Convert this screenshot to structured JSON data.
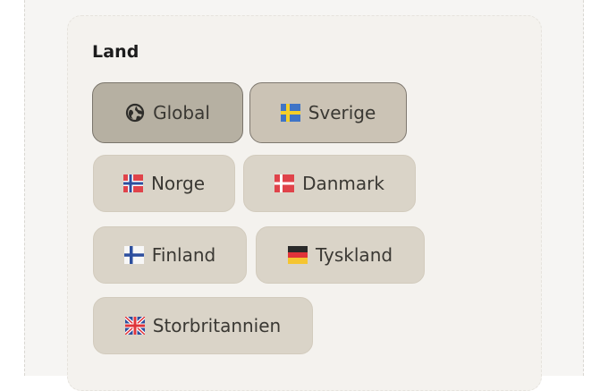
{
  "section": {
    "label": "Land"
  },
  "countries": [
    {
      "label": "Global",
      "icon": "globe-icon",
      "state": "active"
    },
    {
      "label": "Sverige",
      "icon": "flag-sweden-icon",
      "state": "selected"
    },
    {
      "label": "Norge",
      "icon": "flag-norway-icon",
      "state": "default"
    },
    {
      "label": "Danmark",
      "icon": "flag-denmark-icon",
      "state": "default"
    },
    {
      "label": "Finland",
      "icon": "flag-finland-icon",
      "state": "default"
    },
    {
      "label": "Tyskland",
      "icon": "flag-germany-icon",
      "state": "default"
    },
    {
      "label": "Storbritannien",
      "icon": "flag-uk-icon",
      "state": "default"
    }
  ],
  "colors": {
    "chip_default": "#dad4c8",
    "chip_selected": "#cbc3b5",
    "chip_active": "#b6b0a2",
    "text": "#3a3833"
  }
}
